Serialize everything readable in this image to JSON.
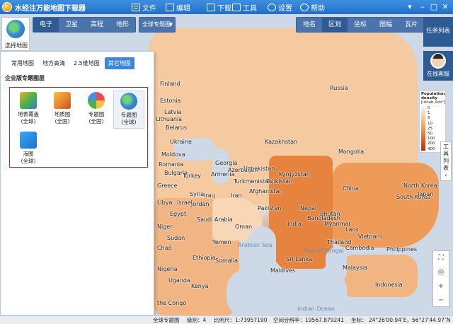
{
  "app": {
    "title": "水经注万能地图下载器"
  },
  "menu": [
    {
      "label": "文件",
      "icon": "file-icon"
    },
    {
      "label": "编辑",
      "icon": "edit-icon"
    },
    {
      "label": "下载",
      "icon": "download-icon"
    },
    {
      "label": "工具",
      "icon": "tools-icon"
    },
    {
      "label": "设置",
      "icon": "settings-icon"
    },
    {
      "label": "帮助",
      "icon": "help-icon"
    }
  ],
  "toolbar_left": [
    "电子",
    "卫星",
    "高程",
    "地形"
  ],
  "toolbar_left_active": "电子",
  "topic_dropdown": "全球专题图",
  "toolbar_right": [
    "地名",
    "区划",
    "坐标",
    "图幅",
    "瓦片"
  ],
  "toolbar_right_active": "区划",
  "side_buttons": {
    "task_list": "任务列表",
    "online_service": "在线客服",
    "tool_list": "工具列表"
  },
  "select_map": "选择地图",
  "panel": {
    "tabs": [
      "常用地图",
      "地方高清",
      "2.5维地图",
      "其它地图"
    ],
    "active_tab": "其它地图",
    "section_title": "企业版专题图层",
    "items": [
      {
        "label": "地表覆盖(全球)",
        "line1": "地表覆盖",
        "line2": "(全球)"
      },
      {
        "label": "地质图(全国)",
        "line1": "地质图",
        "line2": "(全国)"
      },
      {
        "label": "专题图(全国)",
        "line1": "专题图",
        "line2": "(全国)"
      },
      {
        "label": "专题图(全球)",
        "line1": "专题图",
        "line2": "(全球)",
        "selected": true
      },
      {
        "label": "海图(全球)",
        "line1": "海图",
        "line2": "(全球)"
      }
    ]
  },
  "legend": {
    "title_line1": "Population",
    "title_line2": "density",
    "title_line3": "[inhab./km²]",
    "ticks": [
      "0",
      "1",
      "5",
      "10",
      "25",
      "50",
      "100",
      "200",
      "400",
      "800 >"
    ],
    "colors": [
      "#fff3e6",
      "#f6c79c",
      "#ee9a58",
      "#d9631e",
      "#a9370d"
    ]
  },
  "map_labels": [
    "Finland",
    "Russia",
    "Estonia",
    "Latvia",
    "Lithuania",
    "Belarus",
    "Ukraine",
    "Moldova",
    "Romania",
    "Bulgaria",
    "Turkey",
    "Georgia",
    "Armenia",
    "Azerbaijan",
    "Kazakhstan",
    "Uzbekistan",
    "Kyrgyzstan",
    "Tajikistan",
    "Turkmenistan",
    "Mongolia",
    "China",
    "Syria",
    "Iraq",
    "Iran",
    "Afghanistan",
    "Pakistan",
    "Nepal",
    "Bhutan",
    "Bangladesh",
    "India",
    "Myanmar",
    "Laos",
    "Vietnam",
    "Thailand",
    "Cambodia",
    "Philippines",
    "Sri Lanka",
    "Maldives",
    "Malaysia",
    "Indonesia",
    "Saudi Arabia",
    "Oman",
    "Yemen",
    "Egypt",
    "Sudan",
    "Ethiopia",
    "Somalia",
    "Kenya",
    "Uganda",
    "Chad",
    "the Congo",
    "Jordan",
    "Israel",
    "Greece",
    "Libya",
    "Niger",
    "Nigeria",
    "South Korea",
    "North Korea",
    "Japan",
    "Arabian Sea",
    "Bay of Bengal",
    "Indian Ocean"
  ],
  "status": {
    "layer": "全球专题图",
    "level": "级别：4",
    "scale": "比例尺：1:73957190",
    "resolution": "空间分辨率：19567.879241",
    "coords": "坐标：  24°26′00.94″E，56°27′44.97″N"
  }
}
